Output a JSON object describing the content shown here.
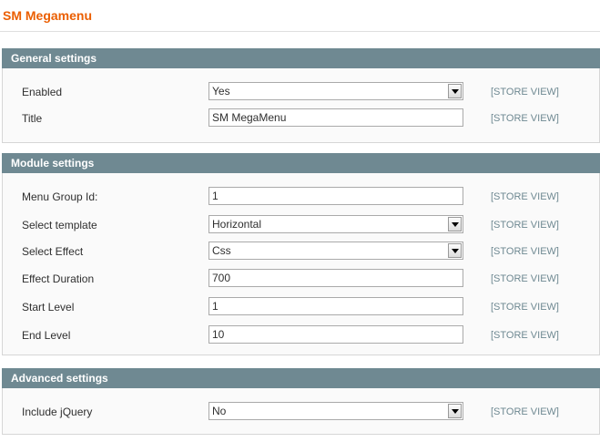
{
  "page": {
    "title": "SM Megamenu"
  },
  "general": {
    "header": "General settings",
    "enabled": {
      "label": "Enabled",
      "value": "Yes",
      "scope": "[STORE VIEW]"
    },
    "title": {
      "label": "Title",
      "value": "SM MegaMenu",
      "scope": "[STORE VIEW]"
    }
  },
  "module": {
    "header": "Module settings",
    "menu_group_id": {
      "label": "Menu Group Id:",
      "value": "1",
      "scope": "[STORE VIEW]"
    },
    "select_template": {
      "label": "Select template",
      "value": "Horizontal",
      "scope": "[STORE VIEW]"
    },
    "select_effect": {
      "label": "Select Effect",
      "value": "Css",
      "scope": "[STORE VIEW]"
    },
    "effect_duration": {
      "label": "Effect Duration",
      "value": "700",
      "scope": "[STORE VIEW]"
    },
    "start_level": {
      "label": "Start Level",
      "value": "1",
      "scope": "[STORE VIEW]"
    },
    "end_level": {
      "label": "End Level",
      "value": "10",
      "scope": "[STORE VIEW]"
    }
  },
  "advanced": {
    "header": "Advanced settings",
    "include_jquery": {
      "label": "Include jQuery",
      "value": "No",
      "scope": "[STORE VIEW]"
    }
  },
  "icons": {
    "dropdown": "chevron-down-icon"
  },
  "colors": {
    "title": "#eb5e00",
    "header_bg": "#6f8992",
    "scope_text": "#6f8992"
  }
}
